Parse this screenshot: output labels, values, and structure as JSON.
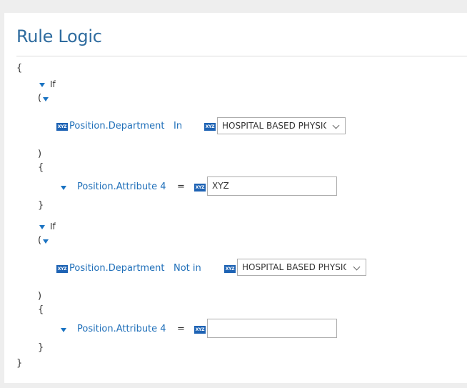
{
  "title": "Rule Logic",
  "braces": {
    "open": "{",
    "close": "}",
    "paren_open": "(",
    "paren_close": ")"
  },
  "rules": [
    {
      "keyword": "If",
      "condition": {
        "field": "Position.Department",
        "operator": "In",
        "value": "HOSPITAL BASED PHYSICIAN"
      },
      "action": {
        "field": "Position.Attribute 4",
        "operator": "=",
        "value": "XYZ"
      }
    },
    {
      "keyword": "If",
      "condition": {
        "field": "Position.Department",
        "operator": "Not in",
        "value": "HOSPITAL BASED PHYSICIAN"
      },
      "action": {
        "field": "Position.Attribute 4",
        "operator": "=",
        "value": ""
      }
    }
  ],
  "type_badge": "XYZ",
  "colors": {
    "accent": "#1f6fb9",
    "badge": "#1e63b4",
    "title": "#2f6c9f"
  }
}
